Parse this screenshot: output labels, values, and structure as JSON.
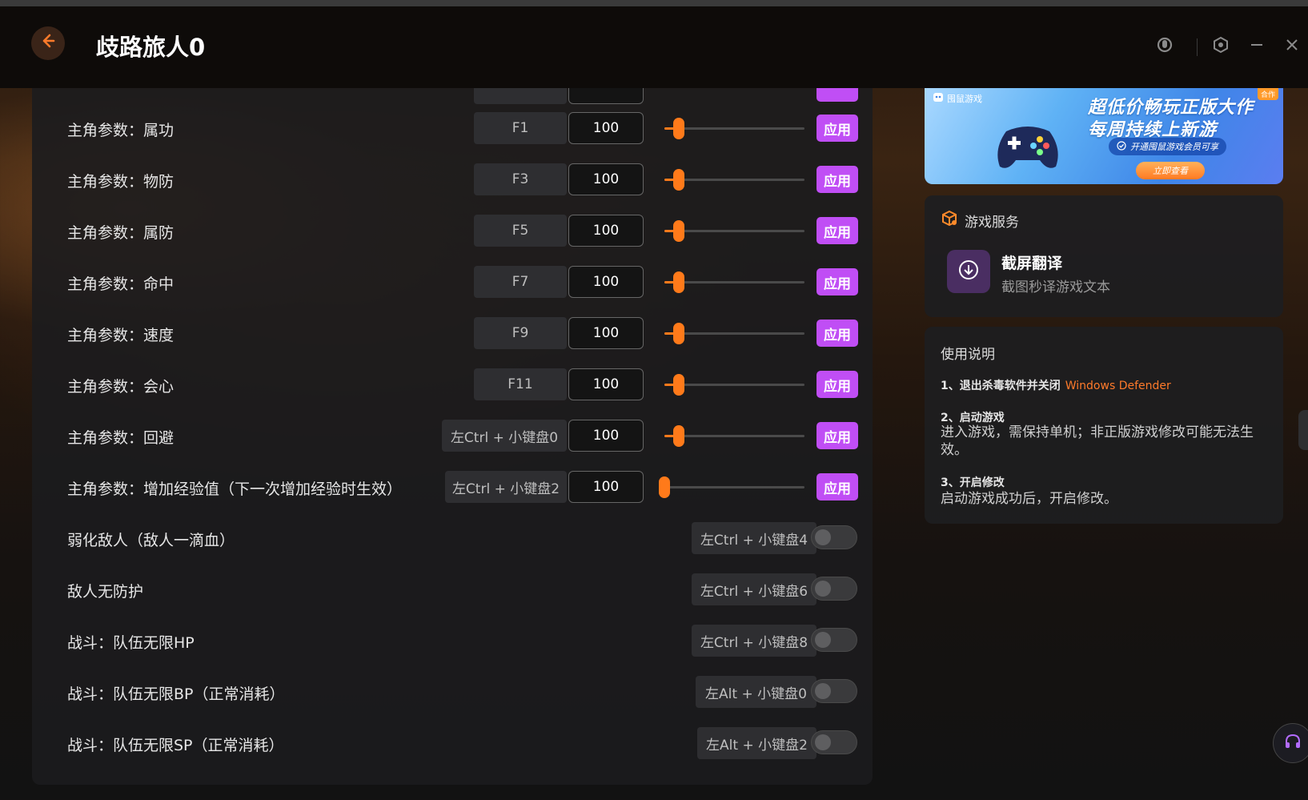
{
  "app": {
    "title": "歧路旅人0",
    "back_icon": "arrow-left-icon",
    "window_controls": [
      "headset-status-icon",
      "settings-hex-icon",
      "minimize-icon",
      "close-icon"
    ]
  },
  "colors": {
    "accent_orange": "#ff7a1a",
    "apply_purple": "#c04ef5",
    "panel_bg": "#1c1c1e"
  },
  "slider_rows": [
    {
      "label": "主角参数：属功",
      "hotkey": "F1",
      "value": "100",
      "level": 0.1,
      "apply": "应用"
    },
    {
      "label": "主角参数：物防",
      "hotkey": "F3",
      "value": "100",
      "level": 0.1,
      "apply": "应用"
    },
    {
      "label": "主角参数：属防",
      "hotkey": "F5",
      "value": "100",
      "level": 0.1,
      "apply": "应用"
    },
    {
      "label": "主角参数：命中",
      "hotkey": "F7",
      "value": "100",
      "level": 0.1,
      "apply": "应用"
    },
    {
      "label": "主角参数：速度",
      "hotkey": "F9",
      "value": "100",
      "level": 0.1,
      "apply": "应用"
    },
    {
      "label": "主角参数：会心",
      "hotkey": "F11",
      "value": "100",
      "level": 0.1,
      "apply": "应用"
    },
    {
      "label": "主角参数：回避",
      "hotkey": "左Ctrl + 小键盘0",
      "value": "100",
      "level": 0.1,
      "apply": "应用"
    },
    {
      "label": "主角参数：增加经验值（下一次增加经验时生效）",
      "hotkey": "左Ctrl + 小键盘2",
      "value": "100",
      "level": 0.0,
      "apply": "应用"
    }
  ],
  "toggle_rows": [
    {
      "label": "弱化敌人（敌人一滴血）",
      "hotkey": "左Ctrl + 小键盘4",
      "on": false
    },
    {
      "label": "敌人无防护",
      "hotkey": "左Ctrl + 小键盘6",
      "on": false
    },
    {
      "label": "战斗：队伍无限HP",
      "hotkey": "左Ctrl + 小键盘8",
      "on": false
    },
    {
      "label": "战斗：队伍无限BP（正常消耗）",
      "hotkey": "左Alt + 小键盘0",
      "on": false
    },
    {
      "label": "战斗：队伍无限SP（正常消耗）",
      "hotkey": "左Alt + 小键盘2",
      "on": false
    }
  ],
  "banner": {
    "brand": "囤鼠游戏",
    "badge": "合作",
    "headline1": "超低价畅玩正版大作",
    "headline2": "每周持续上新游",
    "pill": "开通囤鼠游戏会员可享",
    "cta": "立即查看"
  },
  "service": {
    "heading": "游戏服务",
    "item_name": "截屏翻译",
    "item_desc": "截图秒译游戏文本"
  },
  "usage": {
    "heading": "使用说明",
    "step1_title": "1、退出杀毒软件并关闭",
    "step1_accent": "Windows Defender",
    "step2_title": "2、启动游戏",
    "step2_body": "进入游戏，需保持单机；非正版游戏修改可能无法生效。",
    "step3_title": "3、开启修改",
    "step3_body": "启动游戏成功后，开启修改。"
  }
}
